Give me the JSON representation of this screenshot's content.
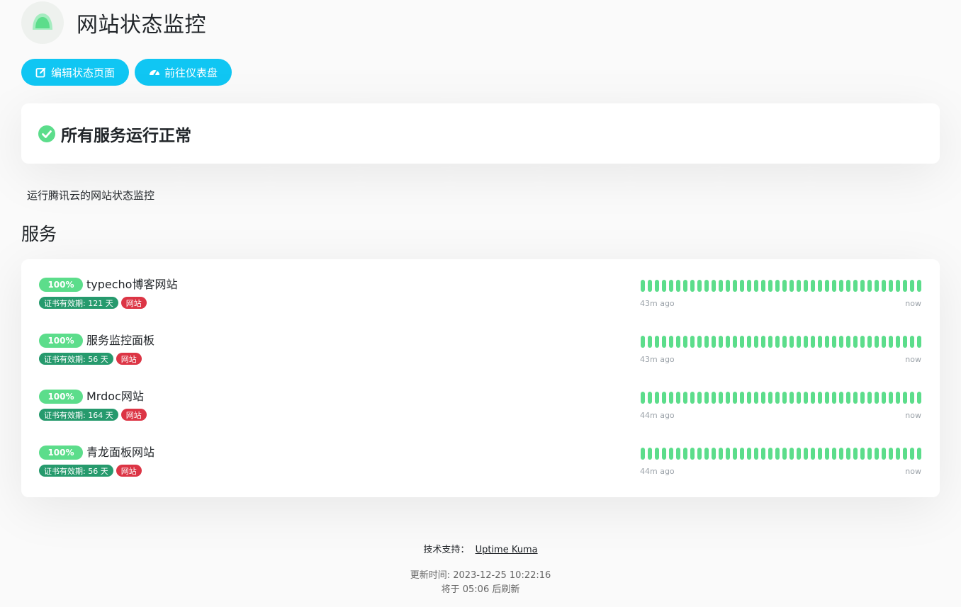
{
  "header": {
    "title": "网站状态监控"
  },
  "actions": {
    "edit_label": "编辑状态页面",
    "dashboard_label": "前往仪表盘"
  },
  "overall_status": {
    "text": "所有服务运行正常",
    "color": "#5cdd8b"
  },
  "description": "运行腾讯云的网站状态监控",
  "section_title": "服务",
  "monitors": [
    {
      "uptime": "100%",
      "name": "typecho博客网站",
      "cert_tag": "证书有效期: 121 天",
      "type_tag": "网站",
      "time_ago": "43m ago",
      "time_now": "now",
      "beat_status": "up"
    },
    {
      "uptime": "100%",
      "name": "服务监控面板",
      "cert_tag": "证书有效期: 56 天",
      "type_tag": "网站",
      "time_ago": "43m ago",
      "time_now": "now",
      "beat_status": "up"
    },
    {
      "uptime": "100%",
      "name": "Mrdoc网站",
      "cert_tag": "证书有效期: 164 天",
      "type_tag": "网站",
      "time_ago": "44m ago",
      "time_now": "now",
      "beat_status": "up"
    },
    {
      "uptime": "100%",
      "name": "青龙面板网站",
      "cert_tag": "证书有效期: 56 天",
      "type_tag": "网站",
      "time_ago": "44m ago",
      "time_now": "now",
      "beat_status": "up"
    }
  ],
  "footer": {
    "powered_by_label": "技术支持：",
    "powered_by_link": "Uptime Kuma",
    "updated_label": "更新时间: 2023-12-25 10:22:16",
    "refresh_label": "将于 05:06 后刷新"
  },
  "colors": {
    "accent": "#10c6f3",
    "up": "#5cdd8b",
    "cert_tag": "#269a6d",
    "type_tag": "#dc3545"
  },
  "icons": {
    "logo": "uptime-kuma-logo",
    "edit": "edit-icon",
    "dashboard": "tachometer-icon",
    "status": "check-circle-icon"
  }
}
